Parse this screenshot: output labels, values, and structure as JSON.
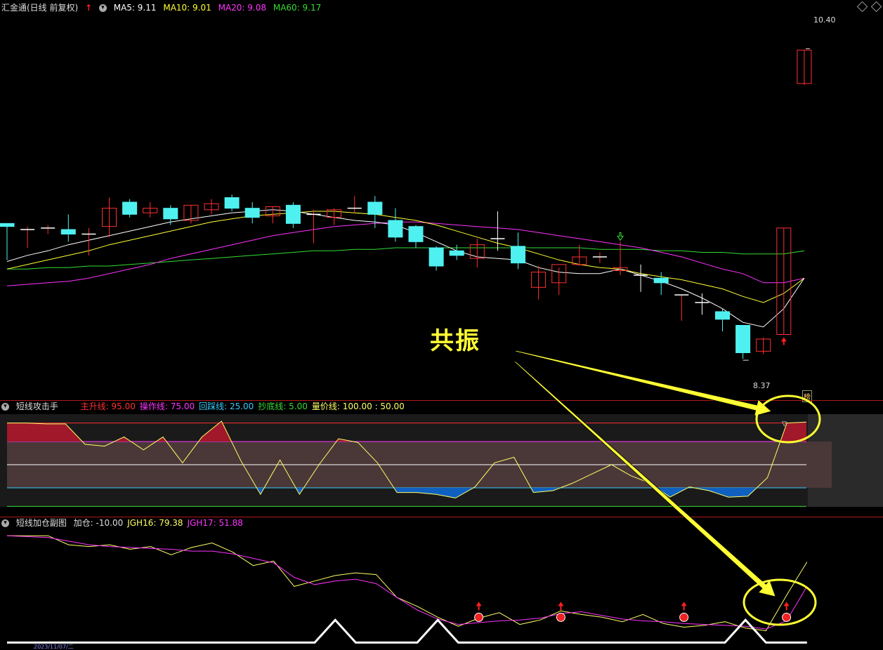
{
  "main": {
    "title": "汇金通(日线 前复权)",
    "ma5": "MA5: 9.11",
    "ma10": "MA10: 9.01",
    "ma20": "MA20: 9.08",
    "ma60": "MA60: 9.17",
    "high_label": "10.40",
    "low_label": "8.37",
    "badge": "榜",
    "colors": {
      "ma5": "#ffffff",
      "ma10": "#ffff33",
      "ma20": "#ff33ff",
      "ma60": "#33dd33",
      "up": "#ff3030",
      "down": "#4ff0f0"
    },
    "chart_data": {
      "type": "candlestick",
      "ylim": [
        8.2,
        10.6
      ],
      "candles": [
        {
          "o": 9.26,
          "h": 9.26,
          "l": 9.02,
          "c": 9.24
        },
        {
          "o": 9.21,
          "h": 9.24,
          "l": 9.1,
          "c": 9.22
        },
        {
          "o": 9.23,
          "h": 9.25,
          "l": 9.19,
          "c": 9.23
        },
        {
          "o": 9.22,
          "h": 9.32,
          "l": 9.14,
          "c": 9.19
        },
        {
          "o": 9.18,
          "h": 9.23,
          "l": 9.05,
          "c": 9.19
        },
        {
          "o": 9.24,
          "h": 9.43,
          "l": 9.17,
          "c": 9.36
        },
        {
          "o": 9.4,
          "h": 9.42,
          "l": 9.3,
          "c": 9.32
        },
        {
          "o": 9.33,
          "h": 9.4,
          "l": 9.3,
          "c": 9.36
        },
        {
          "o": 9.36,
          "h": 9.38,
          "l": 9.25,
          "c": 9.29
        },
        {
          "o": 9.28,
          "h": 9.38,
          "l": 9.26,
          "c": 9.38
        },
        {
          "o": 9.35,
          "h": 9.42,
          "l": 9.32,
          "c": 9.39
        },
        {
          "o": 9.43,
          "h": 9.45,
          "l": 9.34,
          "c": 9.36
        },
        {
          "o": 9.36,
          "h": 9.4,
          "l": 9.26,
          "c": 9.3
        },
        {
          "o": 9.31,
          "h": 9.37,
          "l": 9.26,
          "c": 9.37
        },
        {
          "o": 9.38,
          "h": 9.4,
          "l": 9.23,
          "c": 9.26
        },
        {
          "o": 9.31,
          "h": 9.35,
          "l": 9.13,
          "c": 9.32
        },
        {
          "o": 9.3,
          "h": 9.36,
          "l": 9.25,
          "c": 9.35
        },
        {
          "o": 9.36,
          "h": 9.44,
          "l": 9.33,
          "c": 9.36
        },
        {
          "o": 9.4,
          "h": 9.44,
          "l": 9.23,
          "c": 9.32
        },
        {
          "o": 9.28,
          "h": 9.36,
          "l": 9.14,
          "c": 9.17
        },
        {
          "o": 9.24,
          "h": 9.25,
          "l": 9.1,
          "c": 9.14
        },
        {
          "o": 9.1,
          "h": 9.11,
          "l": 8.95,
          "c": 8.98
        },
        {
          "o": 9.08,
          "h": 9.12,
          "l": 9.02,
          "c": 9.05
        },
        {
          "o": 9.03,
          "h": 9.16,
          "l": 8.97,
          "c": 9.12
        },
        {
          "o": 9.16,
          "h": 9.34,
          "l": 9.08,
          "c": 9.15
        },
        {
          "o": 9.11,
          "h": 9.2,
          "l": 8.96,
          "c": 9.0
        },
        {
          "o": 8.84,
          "h": 8.98,
          "l": 8.76,
          "c": 8.94
        },
        {
          "o": 8.87,
          "h": 8.97,
          "l": 8.79,
          "c": 8.99
        },
        {
          "o": 8.99,
          "h": 9.12,
          "l": 8.98,
          "c": 9.04
        },
        {
          "o": 9.04,
          "h": 9.07,
          "l": 9.0,
          "c": 9.04
        },
        {
          "o": 8.95,
          "h": 9.14,
          "l": 8.92,
          "c": 8.97
        },
        {
          "o": 8.92,
          "h": 8.99,
          "l": 8.81,
          "c": 8.91
        },
        {
          "o": 8.9,
          "h": 8.94,
          "l": 8.79,
          "c": 8.87
        },
        {
          "o": 8.79,
          "h": 8.79,
          "l": 8.62,
          "c": 8.79
        },
        {
          "o": 8.74,
          "h": 8.8,
          "l": 8.66,
          "c": 8.73
        },
        {
          "o": 8.68,
          "h": 8.7,
          "l": 8.55,
          "c": 8.63
        },
        {
          "o": 8.59,
          "h": 8.59,
          "l": 8.37,
          "c": 8.41
        },
        {
          "o": 8.42,
          "h": 8.51,
          "l": 8.4,
          "c": 8.5
        },
        {
          "o": 8.53,
          "h": 9.23,
          "l": 8.53,
          "c": 9.23
        },
        {
          "o": 10.18,
          "h": 10.4,
          "l": 10.17,
          "c": 10.4
        }
      ],
      "ma5": [
        9.01,
        9.05,
        9.08,
        9.12,
        9.15,
        9.18,
        9.21,
        9.24,
        9.27,
        9.29,
        9.31,
        9.33,
        9.34,
        9.35,
        9.34,
        9.32,
        9.3,
        9.28,
        9.27,
        9.25,
        9.2,
        9.14,
        9.08,
        9.04,
        9.03,
        9.02,
        8.97,
        8.94,
        8.93,
        8.93,
        8.96,
        8.92,
        8.88,
        8.83,
        8.77,
        8.7,
        8.61,
        8.58,
        8.7,
        8.9
      ],
      "ma10": [
        8.96,
        8.99,
        9.02,
        9.05,
        9.08,
        9.12,
        9.15,
        9.18,
        9.21,
        9.24,
        9.27,
        9.29,
        9.31,
        9.32,
        9.33,
        9.34,
        9.34,
        9.33,
        9.32,
        9.3,
        9.28,
        9.25,
        9.21,
        9.17,
        9.13,
        9.1,
        9.06,
        9.02,
        8.99,
        8.97,
        8.96,
        8.93,
        8.91,
        8.89,
        8.86,
        8.83,
        8.78,
        8.74,
        8.8,
        8.9
      ],
      "ma20": [
        8.85,
        8.86,
        8.87,
        8.88,
        8.9,
        8.93,
        8.96,
        8.99,
        9.03,
        9.06,
        9.09,
        9.12,
        9.15,
        9.18,
        9.2,
        9.22,
        9.24,
        9.25,
        9.26,
        9.27,
        9.27,
        9.26,
        9.25,
        9.24,
        9.23,
        9.22,
        9.2,
        9.18,
        9.16,
        9.14,
        9.12,
        9.1,
        9.07,
        9.04,
        9.0,
        8.96,
        8.93,
        8.87,
        8.87,
        8.9
      ],
      "ma60": [
        8.96,
        8.96,
        8.97,
        8.97,
        8.98,
        8.98,
        8.99,
        9.0,
        9.01,
        9.02,
        9.03,
        9.04,
        9.05,
        9.06,
        9.07,
        9.08,
        9.08,
        9.09,
        9.09,
        9.1,
        9.1,
        9.1,
        9.1,
        9.1,
        9.1,
        9.1,
        9.1,
        9.1,
        9.1,
        9.09,
        9.09,
        9.09,
        9.08,
        9.08,
        9.07,
        9.07,
        9.06,
        9.06,
        9.06,
        9.08
      ]
    }
  },
  "panel1": {
    "name": "短线攻击手",
    "legend": [
      {
        "text": "主升线: 95.00",
        "color": "#ff3030"
      },
      {
        "text": "操作线: 75.00",
        "color": "#ff33ff"
      },
      {
        "text": "回踩线: 25.00",
        "color": "#33ccff"
      },
      {
        "text": "抄底线: 5.00",
        "color": "#33dd33"
      },
      {
        "text": "量价线: 100.00 : 50.00",
        "color": "#ffff66"
      }
    ],
    "chart_data": {
      "type": "line",
      "ylim": [
        0,
        100
      ],
      "levels": {
        "main_rise": 95,
        "operate": 75,
        "mid": 50,
        "pullback": 25,
        "bottom": 5
      },
      "values": [
        95,
        95,
        94,
        94,
        72,
        70,
        80,
        66,
        80,
        52,
        80,
        97,
        54,
        18,
        55,
        18,
        50,
        78,
        74,
        52,
        20,
        20,
        18,
        14,
        26,
        52,
        58,
        20,
        22,
        30,
        40,
        50,
        38,
        30,
        15,
        26,
        22,
        15,
        16,
        36,
        95,
        96
      ]
    }
  },
  "panel2": {
    "name": "短线加仓副图",
    "legend": [
      {
        "text": "加仓: -10.00",
        "color": "#dddddd"
      },
      {
        "text": "JGH16: 79.38",
        "color": "#ffff66"
      },
      {
        "text": "JGH17: 51.88",
        "color": "#ff33ff"
      }
    ],
    "chart_data": {
      "type": "line",
      "ylim": [
        -12,
        112
      ],
      "series": [
        {
          "name": "JGH16",
          "color": "#ffff66",
          "values": [
            108,
            108,
            108,
            98,
            96,
            98,
            93,
            96,
            87,
            95,
            100,
            90,
            75,
            80,
            52,
            58,
            64,
            67,
            65,
            40,
            30,
            18,
            8,
            17,
            23,
            10,
            15,
            25,
            21,
            18,
            13,
            21,
            11,
            7,
            9,
            13,
            6,
            3,
            42,
            79
          ]
        },
        {
          "name": "JGH17",
          "color": "#ff33ff",
          "values": [
            108,
            107,
            106,
            102,
            98,
            96,
            95,
            94,
            93,
            91,
            91,
            88,
            83,
            78,
            62,
            54,
            58,
            60,
            55,
            40,
            26,
            16,
            10,
            12,
            14,
            15,
            17,
            22,
            24,
            20,
            16,
            14,
            13,
            11,
            10,
            9,
            8,
            5,
            14,
            52
          ]
        },
        {
          "name": "加仓",
          "color": "#ffffff",
          "values": [
            -10,
            -10,
            -10,
            -10,
            -10,
            -10,
            -10,
            -10,
            -10,
            -10,
            -10,
            -10,
            -10,
            -10,
            -10,
            -10,
            15,
            -10,
            -10,
            -10,
            -10,
            15,
            -10,
            -10,
            -10,
            -10,
            -10,
            -10,
            -10,
            -10,
            -10,
            -10,
            -10,
            -10,
            -10,
            -10,
            15,
            -10,
            -10,
            -10
          ]
        }
      ],
      "signals": [
        23,
        27,
        33,
        38
      ]
    }
  },
  "annotation": {
    "callout": "共振"
  },
  "footer": {
    "date": "2023/11/07/二"
  }
}
